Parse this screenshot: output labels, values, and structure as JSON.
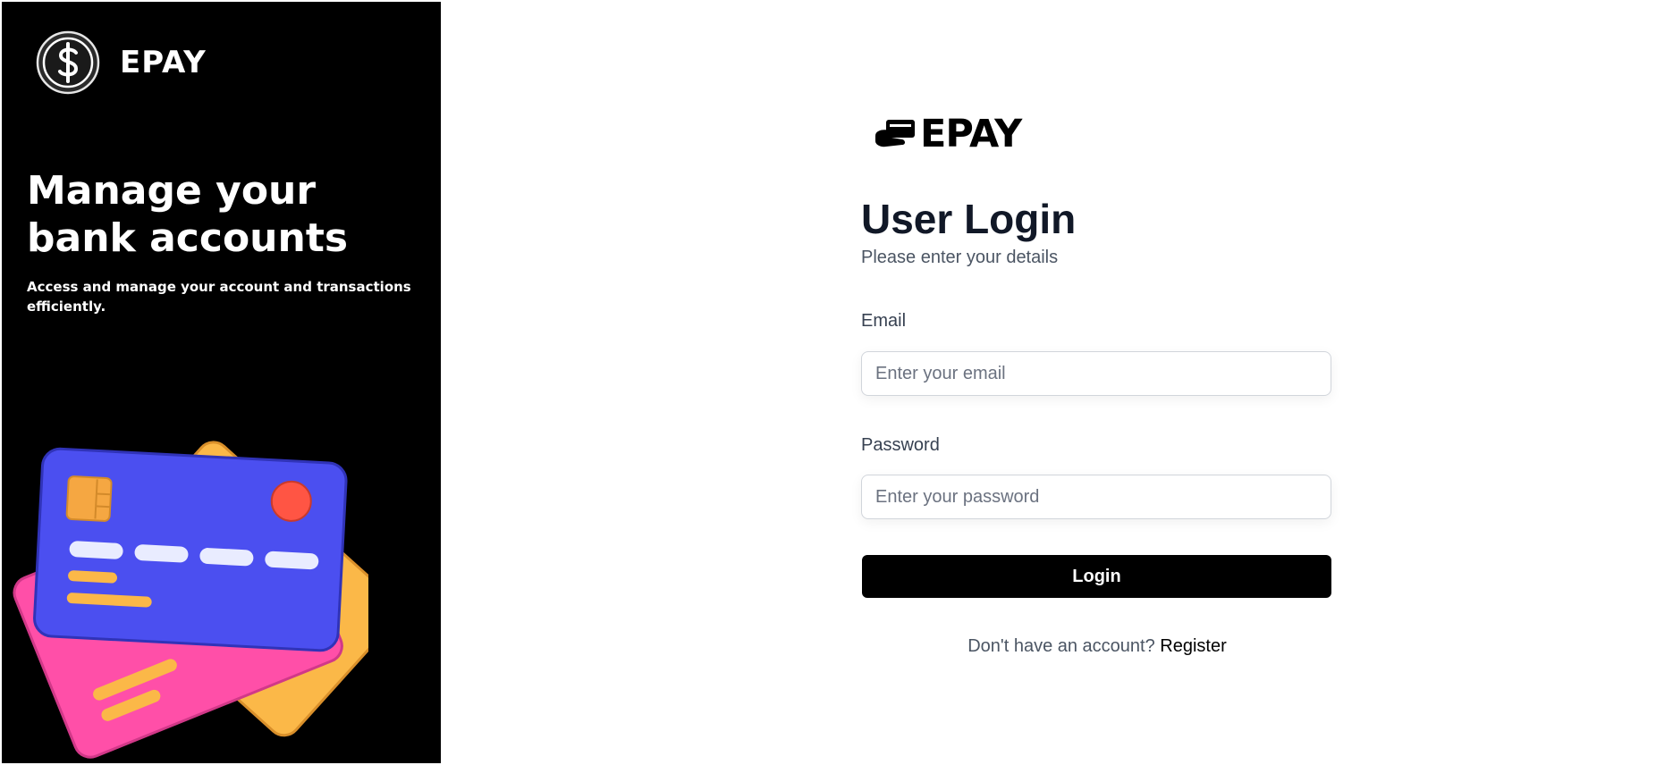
{
  "sidebar": {
    "brand_name": "EPAY",
    "logo_icon": "dollar-coin-icon",
    "hero_title": "Manage your bank accounts",
    "hero_subtitle": "Access and manage your account and transactions efficiently.",
    "illustration": "credit-cards-illustration",
    "background_color": "#000000"
  },
  "login": {
    "logo_icon": "hand-card-icon",
    "logo_text": "EPAY",
    "title": "User Login",
    "subtitle": "Please enter your details",
    "email": {
      "label": "Email",
      "placeholder": "Enter your email",
      "value": ""
    },
    "password": {
      "label": "Password",
      "placeholder": "Enter your password",
      "value": ""
    },
    "submit_label": "Login",
    "register_prompt": "Don't have an account?",
    "register_link": "Register",
    "button_color": "#000000"
  }
}
